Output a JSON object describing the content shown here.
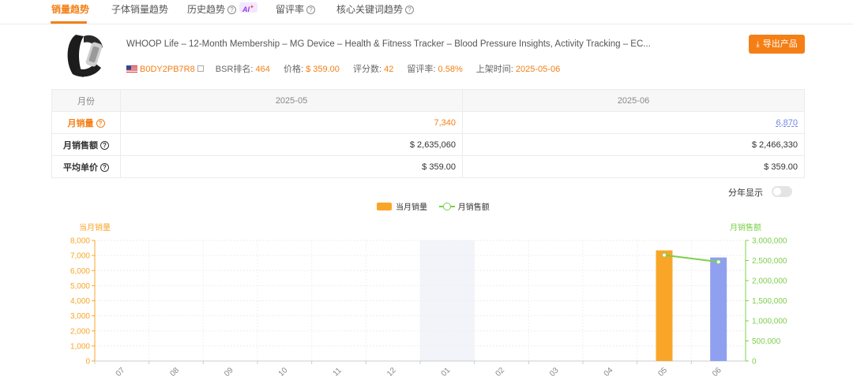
{
  "tabs": [
    {
      "label": "销量趋势",
      "active": true
    },
    {
      "label": "子体销量趋势"
    },
    {
      "label": "历史趋势",
      "badge": "AI"
    },
    {
      "label": "留评率"
    },
    {
      "label": "核心关键词趋势"
    }
  ],
  "product": {
    "title": "WHOOP Life – 12-Month Membership – MG Device – Health & Fitness Tracker – Blood Pressure Insights, Activity Tracking – EC...",
    "asin": "B0DY2PB7R8",
    "bsr_label": "BSR排名:",
    "bsr": "464",
    "price_label": "价格:",
    "price": "$ 359.00",
    "ratings_label": "评分数:",
    "ratings": "42",
    "review_rate_label": "留评率:",
    "review_rate": "0.58%",
    "listed_label": "上架时间:",
    "listed": "2025-05-06",
    "export_label": "导出产品"
  },
  "table": {
    "header": "月份",
    "months": [
      "2025-05",
      "2025-06"
    ],
    "rows": [
      {
        "label": "月销量",
        "values": [
          "7,340",
          "6,870"
        ]
      },
      {
        "label": "月销售额",
        "values": [
          "$ 2,635,060",
          "$ 2,466,330"
        ]
      },
      {
        "label": "平均单价",
        "values": [
          "$ 359.00",
          "$ 359.00"
        ]
      }
    ]
  },
  "toggle_label": "分年显示",
  "chart_data": {
    "type": "bar",
    "legend": [
      "当月销量",
      "月销售额"
    ],
    "ylabel_left": "当月销量",
    "ylabel_right": "月销售额",
    "ylim_left": [
      0,
      8000
    ],
    "ylim_right": [
      0,
      3000000
    ],
    "yticks_left": [
      "0",
      "1,000",
      "2,000",
      "3,000",
      "4,000",
      "5,000",
      "6,000",
      "7,000",
      "8,000"
    ],
    "yticks_right": [
      "0",
      "500,000",
      "1,000,000",
      "1,500,000",
      "2,000,000",
      "2,500,000",
      "3,000,000"
    ],
    "categories": [
      "07",
      "08",
      "09",
      "10",
      "11",
      "12",
      "01",
      "02",
      "03",
      "04",
      "05",
      "06"
    ],
    "series": [
      {
        "name": "当月销量",
        "type": "bar",
        "values": [
          0,
          0,
          0,
          0,
          0,
          0,
          0,
          0,
          0,
          0,
          7340,
          6870
        ],
        "colors": [
          "#f9a628",
          "#8fa0f0"
        ]
      },
      {
        "name": "月销售额",
        "type": "line",
        "values": [
          null,
          null,
          null,
          null,
          null,
          null,
          null,
          null,
          null,
          null,
          2635060,
          2466330
        ],
        "color": "#7ccf4a"
      }
    ],
    "highlight_category": "01",
    "colors": {
      "left_axis": "#f9a628",
      "right_axis": "#7ccf4a",
      "highlight": "#f3f4f9"
    }
  }
}
